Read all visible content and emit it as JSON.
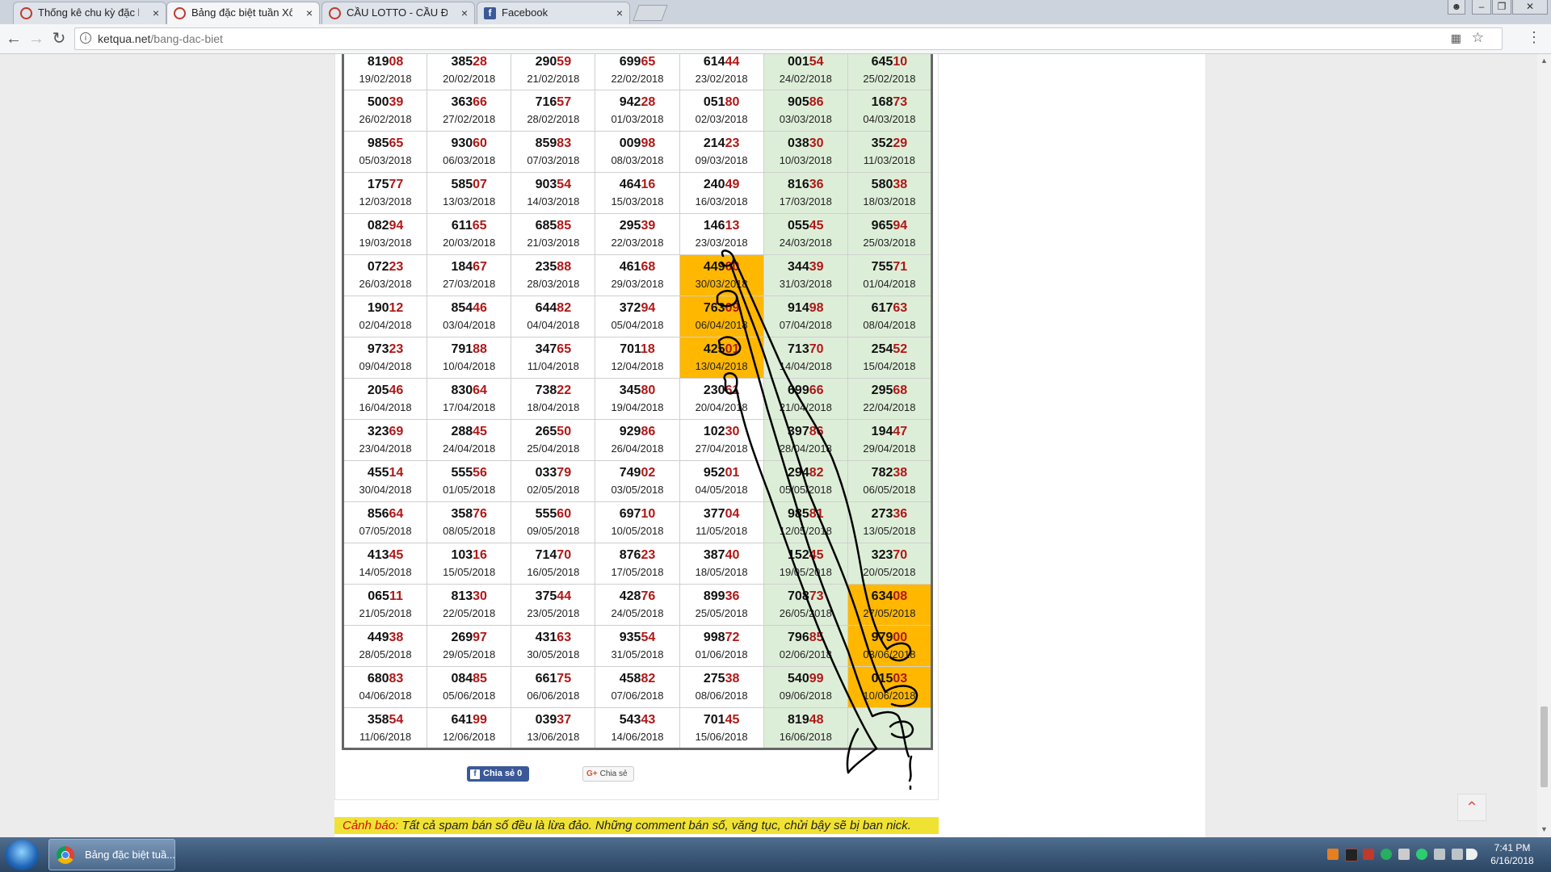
{
  "browser": {
    "tabs": [
      {
        "label": "Thống kê chu kỳ đặc biệ",
        "active": false,
        "icon": "ketqua-favicon"
      },
      {
        "label": "Bảng đặc biệt tuần Xổ Số",
        "active": true,
        "icon": "ketqua-favicon"
      },
      {
        "label": "CẦU LOTTO - CẦU ĐB NI",
        "active": false,
        "icon": "ketqua-favicon"
      },
      {
        "label": "Facebook",
        "active": false,
        "icon": "facebook-favicon"
      }
    ],
    "tab_close": "×",
    "url_domain": "ketqua.net",
    "url_path": "/bang-dac-biet"
  },
  "table": {
    "rows": [
      [
        [
          "81908",
          "19/02/2018"
        ],
        [
          "38528",
          "20/02/2018"
        ],
        [
          "29059",
          "21/02/2018"
        ],
        [
          "69965",
          "22/02/2018"
        ],
        [
          "61444",
          "23/02/2018"
        ],
        [
          "00154",
          "24/02/2018"
        ],
        [
          "64510",
          "25/02/2018"
        ]
      ],
      [
        [
          "50039",
          "26/02/2018"
        ],
        [
          "36366",
          "27/02/2018"
        ],
        [
          "71657",
          "28/02/2018"
        ],
        [
          "94228",
          "01/03/2018"
        ],
        [
          "05180",
          "02/03/2018"
        ],
        [
          "90586",
          "03/03/2018"
        ],
        [
          "16873",
          "04/03/2018"
        ]
      ],
      [
        [
          "98565",
          "05/03/2018"
        ],
        [
          "93060",
          "06/03/2018"
        ],
        [
          "85983",
          "07/03/2018"
        ],
        [
          "00998",
          "08/03/2018"
        ],
        [
          "21423",
          "09/03/2018"
        ],
        [
          "03830",
          "10/03/2018"
        ],
        [
          "35229",
          "11/03/2018"
        ]
      ],
      [
        [
          "17577",
          "12/03/2018"
        ],
        [
          "58507",
          "13/03/2018"
        ],
        [
          "90354",
          "14/03/2018"
        ],
        [
          "46416",
          "15/03/2018"
        ],
        [
          "24049",
          "16/03/2018"
        ],
        [
          "81636",
          "17/03/2018"
        ],
        [
          "58038",
          "18/03/2018"
        ]
      ],
      [
        [
          "08294",
          "19/03/2018"
        ],
        [
          "61165",
          "20/03/2018"
        ],
        [
          "68585",
          "21/03/2018"
        ],
        [
          "29539",
          "22/03/2018"
        ],
        [
          "14613",
          "23/03/2018"
        ],
        [
          "05545",
          "24/03/2018"
        ],
        [
          "96594",
          "25/03/2018"
        ]
      ],
      [
        [
          "07223",
          "26/03/2018"
        ],
        [
          "18467",
          "27/03/2018"
        ],
        [
          "23588",
          "28/03/2018"
        ],
        [
          "46168",
          "29/03/2018"
        ],
        [
          "44900",
          "30/03/2018"
        ],
        [
          "34439",
          "31/03/2018"
        ],
        [
          "75571",
          "01/04/2018"
        ]
      ],
      [
        [
          "19012",
          "02/04/2018"
        ],
        [
          "85446",
          "03/04/2018"
        ],
        [
          "64482",
          "04/04/2018"
        ],
        [
          "37294",
          "05/04/2018"
        ],
        [
          "76309",
          "06/04/2018"
        ],
        [
          "91498",
          "07/04/2018"
        ],
        [
          "61763",
          "08/04/2018"
        ]
      ],
      [
        [
          "97323",
          "09/04/2018"
        ],
        [
          "79188",
          "10/04/2018"
        ],
        [
          "34765",
          "11/04/2018"
        ],
        [
          "70118",
          "12/04/2018"
        ],
        [
          "42501",
          "13/04/2018"
        ],
        [
          "71370",
          "14/04/2018"
        ],
        [
          "25452",
          "15/04/2018"
        ]
      ],
      [
        [
          "20546",
          "16/04/2018"
        ],
        [
          "83064",
          "17/04/2018"
        ],
        [
          "73822",
          "18/04/2018"
        ],
        [
          "34580",
          "19/04/2018"
        ],
        [
          "23061",
          "20/04/2018"
        ],
        [
          "69966",
          "21/04/2018"
        ],
        [
          "29568",
          "22/04/2018"
        ]
      ],
      [
        [
          "32369",
          "23/04/2018"
        ],
        [
          "28845",
          "24/04/2018"
        ],
        [
          "26550",
          "25/04/2018"
        ],
        [
          "92986",
          "26/04/2018"
        ],
        [
          "10230",
          "27/04/2018"
        ],
        [
          "39786",
          "28/04/2018"
        ],
        [
          "19447",
          "29/04/2018"
        ]
      ],
      [
        [
          "45514",
          "30/04/2018"
        ],
        [
          "55556",
          "01/05/2018"
        ],
        [
          "03379",
          "02/05/2018"
        ],
        [
          "74902",
          "03/05/2018"
        ],
        [
          "95201",
          "04/05/2018"
        ],
        [
          "29482",
          "05/05/2018"
        ],
        [
          "78238",
          "06/05/2018"
        ]
      ],
      [
        [
          "85664",
          "07/05/2018"
        ],
        [
          "35876",
          "08/05/2018"
        ],
        [
          "55560",
          "09/05/2018"
        ],
        [
          "69710",
          "10/05/2018"
        ],
        [
          "37704",
          "11/05/2018"
        ],
        [
          "98581",
          "12/05/2018"
        ],
        [
          "27336",
          "13/05/2018"
        ]
      ],
      [
        [
          "41345",
          "14/05/2018"
        ],
        [
          "10316",
          "15/05/2018"
        ],
        [
          "71470",
          "16/05/2018"
        ],
        [
          "87623",
          "17/05/2018"
        ],
        [
          "38740",
          "18/05/2018"
        ],
        [
          "15245",
          "19/05/2018"
        ],
        [
          "32370",
          "20/05/2018"
        ]
      ],
      [
        [
          "06511",
          "21/05/2018"
        ],
        [
          "81330",
          "22/05/2018"
        ],
        [
          "37544",
          "23/05/2018"
        ],
        [
          "42876",
          "24/05/2018"
        ],
        [
          "89936",
          "25/05/2018"
        ],
        [
          "70873",
          "26/05/2018"
        ],
        [
          "63408",
          "27/05/2018"
        ]
      ],
      [
        [
          "44938",
          "28/05/2018"
        ],
        [
          "26997",
          "29/05/2018"
        ],
        [
          "43163",
          "30/05/2018"
        ],
        [
          "93554",
          "31/05/2018"
        ],
        [
          "99872",
          "01/06/2018"
        ],
        [
          "79685",
          "02/06/2018"
        ],
        [
          "97900",
          "03/06/2018"
        ]
      ],
      [
        [
          "68083",
          "04/06/2018"
        ],
        [
          "08485",
          "05/06/2018"
        ],
        [
          "66175",
          "06/06/2018"
        ],
        [
          "45882",
          "07/06/2018"
        ],
        [
          "27538",
          "08/06/2018"
        ],
        [
          "54099",
          "09/06/2018"
        ],
        [
          "01503",
          "10/06/2018"
        ]
      ],
      [
        [
          "35854",
          "11/06/2018"
        ],
        [
          "64199",
          "12/06/2018"
        ],
        [
          "03937",
          "13/06/2018"
        ],
        [
          "54343",
          "14/06/2018"
        ],
        [
          "70145",
          "15/06/2018"
        ],
        [
          "81948",
          "16/06/2018"
        ],
        [
          "",
          ""
        ]
      ]
    ],
    "highlighted_cells": [
      [
        5,
        4
      ],
      [
        6,
        4
      ],
      [
        7,
        4
      ],
      [
        13,
        6
      ],
      [
        14,
        6
      ],
      [
        15,
        6
      ]
    ],
    "weekend_columns": [
      5,
      6
    ]
  },
  "share": {
    "facebook_label": "Chia sẻ 0",
    "gplus_label": "Chia sẻ",
    "gplus_icon": "G+"
  },
  "warning": {
    "label": "Cảnh báo:",
    "text": " Tất cả spam bán số đều là lừa đảo. Những comment bán số, văng tục, chửi bậy sẽ bị ban nick."
  },
  "taskbar": {
    "task_label": "Bảng đặc biệt tuầ...",
    "time": "7:41 PM",
    "date": "6/16/2018"
  },
  "colors": {
    "highlight": "#ffb700",
    "weekend": "#ddeed8",
    "tail_digits": "#b01717",
    "warning_bg": "#f0e233"
  }
}
